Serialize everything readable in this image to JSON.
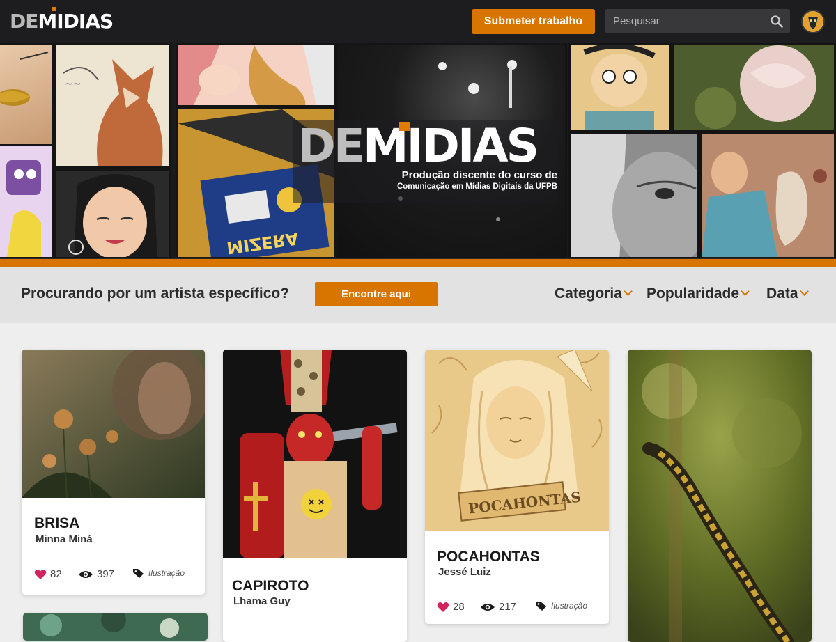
{
  "header": {
    "logo_de": "DE",
    "logo_midias": "MIDIAS",
    "submit_label": "Submeter trabalho",
    "search_placeholder": "Pesquisar"
  },
  "hero": {
    "title_de": "DE",
    "title_midias": "MIDIAS",
    "subtitle_line1": "Produção discente do curso de",
    "subtitle_line2": "Comunicação em Mídias Digitais da UFPB"
  },
  "filterbar": {
    "question": "Procurando por um artista específico?",
    "find_label": "Encontre aqui",
    "filters": [
      "Categoria",
      "Popularidade",
      "Data"
    ]
  },
  "cards": [
    {
      "title": "BRISA",
      "artist": "Minna Miná",
      "likes": "82",
      "views": "397",
      "category": "Ilustração"
    },
    {
      "title": "CAPIROTO",
      "artist": "Lhama Guy"
    },
    {
      "title": "POCAHONTAS",
      "artist": "Jessé Luiz",
      "likes": "28",
      "views": "217",
      "category": "Ilustração"
    },
    {}
  ],
  "artwork_text": {
    "pocahontas_banner": "POCAHONTAS",
    "zine_text": "MIZERA"
  },
  "colors": {
    "accent": "#d87400",
    "header_bg": "#1d1d1f",
    "filterbar_bg": "#e2e2e2",
    "like_heart": "#d0245e"
  }
}
